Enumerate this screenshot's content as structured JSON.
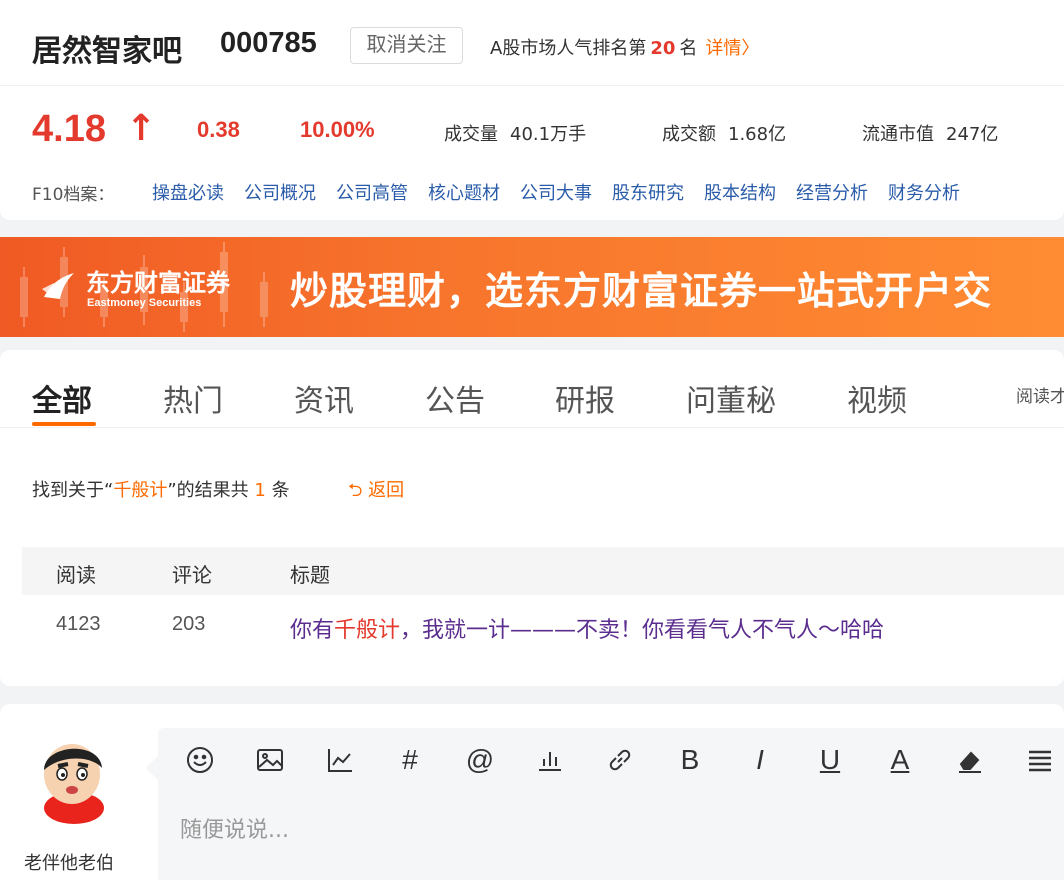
{
  "header": {
    "bar_name": "居然智家吧",
    "stock_code": "000785",
    "follow_button": "取消关注",
    "rank_prefix": "A股市场人气排名第",
    "rank_number": "20",
    "rank_suffix": "名",
    "details_link": "详情",
    "details_chevron": "〉"
  },
  "quote": {
    "price": "4.18",
    "arrow": "↑",
    "change": "0.38",
    "change_pct": "10.00%",
    "volume_label": "成交量",
    "volume_value": "40.1万手",
    "turnover_label": "成交额",
    "turnover_value": "1.68亿",
    "float_cap_label": "流通市值",
    "float_cap_value": "247亿"
  },
  "f10": {
    "label": "F10档案：",
    "links": [
      "操盘必读",
      "公司概况",
      "公司高管",
      "核心题材",
      "公司大事",
      "股东研究",
      "股本结构",
      "经营分析",
      "财务分析"
    ]
  },
  "banner": {
    "logo_cn": "东方财富证券",
    "logo_en": "Eastmoney Securities",
    "slogan": "炒股理财，选东方财富证券一站式开户交"
  },
  "tabs": {
    "items": [
      "全部",
      "热门",
      "资讯",
      "公告",
      "研报",
      "问董秘",
      "视频"
    ],
    "active_index": 0,
    "sort_label": "阅读才"
  },
  "search_result": {
    "prefix": "找到关于“",
    "keyword": "千般计",
    "middle": "”的结果共",
    "count": "1",
    "suffix": "条",
    "back_icon": "⮌",
    "back_label": "返回"
  },
  "table": {
    "columns": [
      "阅读",
      "评论",
      "标题"
    ],
    "rows": [
      {
        "reads": "4123",
        "comments": "203",
        "title_before": "你有",
        "title_highlight": "千般计",
        "title_after": "，我就一计———不卖！你看看气人不气人～哈哈"
      }
    ]
  },
  "comment": {
    "username": "老伴他老伯",
    "placeholder": "随便说说...",
    "toolbar": {
      "emoji": "emoji-icon",
      "image": "image-icon",
      "chart": "chart-icon",
      "topic": "#",
      "mention": "@",
      "stock": "bar-chart-icon",
      "link": "link-icon",
      "bold": "B",
      "italic": "I",
      "underline": "U",
      "font_color": "A",
      "eraser": "eraser-icon",
      "align": "align-icon"
    }
  },
  "colors": {
    "up_red": "#e4392d",
    "accent_orange": "#ff6a00",
    "link_blue": "#2a5caa",
    "visited_purple": "#5b2d8e"
  }
}
